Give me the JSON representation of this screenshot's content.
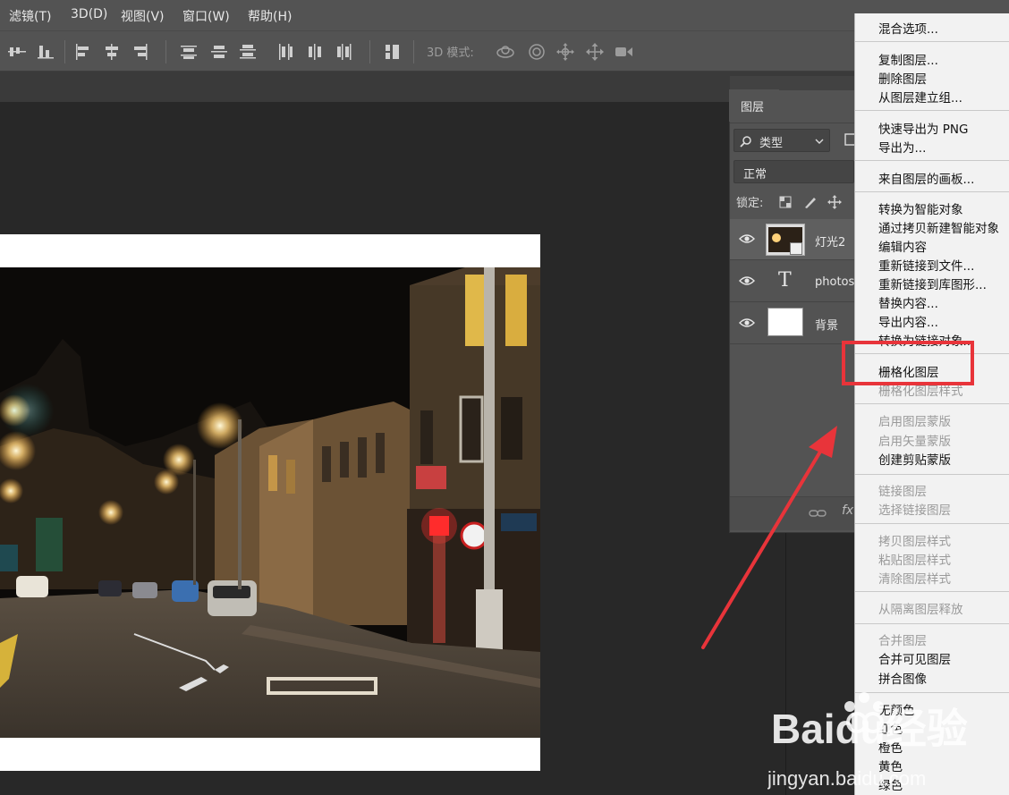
{
  "menubar": {
    "items": [
      {
        "label": "滤镜(T)"
      },
      {
        "label": "3D(D)"
      },
      {
        "label": "视图(V)"
      },
      {
        "label": "窗口(W)"
      },
      {
        "label": "帮助(H)"
      }
    ]
  },
  "optionsbar": {
    "mode_label": "3D 模式:"
  },
  "layers_panel": {
    "tab": "图层",
    "filter_kind": "类型",
    "blend_mode": "正常",
    "lock_label": "锁定:",
    "layers": [
      {
        "name": "灯光2",
        "selected": true,
        "type": "smart-object"
      },
      {
        "name": "photos",
        "selected": false,
        "type": "text"
      },
      {
        "name": "背景",
        "selected": false,
        "type": "pixel"
      }
    ],
    "footer_fx": "fx"
  },
  "context_menu": {
    "groups": [
      [
        {
          "label": "混合选项...",
          "enabled": true
        }
      ],
      [
        {
          "label": "复制图层...",
          "enabled": true
        },
        {
          "label": "删除图层",
          "enabled": true
        },
        {
          "label": "从图层建立组...",
          "enabled": true
        }
      ],
      [
        {
          "label": "快速导出为 PNG",
          "enabled": true
        },
        {
          "label": "导出为...",
          "enabled": true
        }
      ],
      [
        {
          "label": "来自图层的画板...",
          "enabled": true
        }
      ],
      [
        {
          "label": "转换为智能对象",
          "enabled": true
        },
        {
          "label": "通过拷贝新建智能对象",
          "enabled": true
        },
        {
          "label": "编辑内容",
          "enabled": true
        },
        {
          "label": "重新链接到文件...",
          "enabled": true
        },
        {
          "label": "重新链接到库图形...",
          "enabled": true
        },
        {
          "label": "替换内容...",
          "enabled": true
        },
        {
          "label": "导出内容...",
          "enabled": true
        },
        {
          "label": "转换为链接对象...",
          "enabled": true
        }
      ],
      [
        {
          "label": "栅格化图层",
          "enabled": true
        },
        {
          "label": "栅格化图层样式",
          "enabled": false
        }
      ],
      [
        {
          "label": "启用图层蒙版",
          "enabled": false
        },
        {
          "label": "启用矢量蒙版",
          "enabled": false
        },
        {
          "label": "创建剪贴蒙版",
          "enabled": true
        }
      ],
      [
        {
          "label": "链接图层",
          "enabled": false
        },
        {
          "label": "选择链接图层",
          "enabled": false
        }
      ],
      [
        {
          "label": "拷贝图层样式",
          "enabled": false
        },
        {
          "label": "粘贴图层样式",
          "enabled": false
        },
        {
          "label": "清除图层样式",
          "enabled": false
        }
      ],
      [
        {
          "label": "从隔离图层释放",
          "enabled": false
        }
      ],
      [
        {
          "label": "合并图层",
          "enabled": false
        },
        {
          "label": "合并可见图层",
          "enabled": true
        },
        {
          "label": "拼合图像",
          "enabled": true
        }
      ],
      [
        {
          "label": "无颜色",
          "enabled": true
        },
        {
          "label": "红色",
          "enabled": true
        },
        {
          "label": "橙色",
          "enabled": true
        },
        {
          "label": "黄色",
          "enabled": true
        },
        {
          "label": "绿色",
          "enabled": true
        }
      ]
    ],
    "highlighted_item": "栅格化图层"
  },
  "watermark": {
    "brand": "Baidu经验",
    "url": "jingyan.baidu.com"
  },
  "colors": {
    "annotation_red": "#e8343a",
    "ui_panel": "#535353",
    "menu_bg": "#f2f2f2"
  }
}
